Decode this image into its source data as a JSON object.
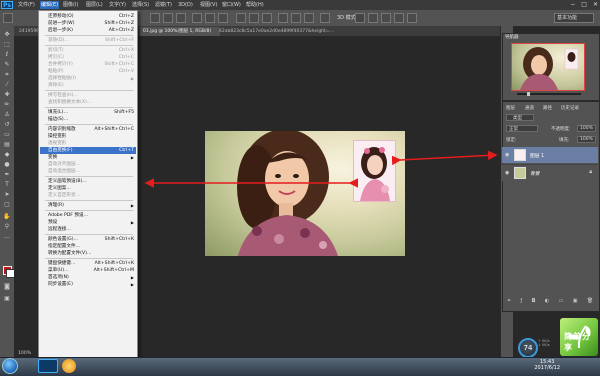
{
  "app": {
    "logo": "Ps"
  },
  "menubar": {
    "items": [
      "文件(F)",
      "编辑(E)",
      "图像(I)",
      "图层(L)",
      "文字(Y)",
      "选择(S)",
      "滤镜(T)",
      "3D(D)",
      "视图(V)",
      "窗口(W)",
      "帮助(H)"
    ],
    "active_index": 1,
    "window_controls": [
      "−",
      "□",
      "✕"
    ]
  },
  "options_bar": {
    "mode_3d": "3D 模式:",
    "workspace": "基本功能"
  },
  "doc_tabs": [
    {
      "label": "2419596…",
      "active": false
    },
    {
      "label": "01.jpg @ 100%(图层 1, RGB/8)",
      "active": true
    },
    {
      "label": "42ab823c8c5a17e0ae2d0e4899f40377&height=…",
      "active": false
    }
  ],
  "edit_menu": {
    "items": [
      {
        "label": "还原移动(O)",
        "shortcut": "Ctrl+Z",
        "disabled": false
      },
      {
        "label": "前进一步(W)",
        "shortcut": "Shift+Ctrl+Z",
        "disabled": false
      },
      {
        "label": "后退一步(K)",
        "shortcut": "Alt+Ctrl+Z",
        "disabled": false
      },
      {
        "sep": true
      },
      {
        "label": "渐隐(D)…",
        "shortcut": "Shift+Ctrl+F",
        "disabled": true
      },
      {
        "sep": true
      },
      {
        "label": "剪切(T)",
        "shortcut": "Ctrl+X",
        "disabled": true
      },
      {
        "label": "拷贝(C)",
        "shortcut": "Ctrl+C",
        "disabled": true
      },
      {
        "label": "合并拷贝(Y)",
        "shortcut": "Shift+Ctrl+C",
        "disabled": true
      },
      {
        "label": "粘贴(P)",
        "shortcut": "Ctrl+V",
        "disabled": true
      },
      {
        "label": "选择性粘贴(I)",
        "shortcut": "",
        "disabled": true,
        "submenu": true
      },
      {
        "label": "清除(E)",
        "shortcut": "",
        "disabled": true
      },
      {
        "sep": true
      },
      {
        "label": "拼写检查(H)…",
        "shortcut": "",
        "disabled": true
      },
      {
        "label": "查找和替换文本(X)…",
        "shortcut": "",
        "disabled": true
      },
      {
        "sep": true
      },
      {
        "label": "填充(L)…",
        "shortcut": "Shift+F5",
        "disabled": false
      },
      {
        "label": "描边(S)…",
        "shortcut": "",
        "disabled": false
      },
      {
        "sep": true
      },
      {
        "label": "内容识别缩放",
        "shortcut": "Alt+Shift+Ctrl+C",
        "disabled": false
      },
      {
        "label": "操控变形",
        "shortcut": "",
        "disabled": false
      },
      {
        "label": "透视变形",
        "shortcut": "",
        "disabled": true
      },
      {
        "label": "自由变换(F)",
        "shortcut": "Ctrl+T",
        "disabled": false,
        "highlight": true
      },
      {
        "label": "变换",
        "shortcut": "",
        "disabled": false,
        "submenu": true
      },
      {
        "label": "自动对齐图层…",
        "shortcut": "",
        "disabled": true
      },
      {
        "label": "自动混合图层…",
        "shortcut": "",
        "disabled": true
      },
      {
        "sep": true
      },
      {
        "label": "定义画笔预设(B)…",
        "shortcut": "",
        "disabled": false
      },
      {
        "label": "定义图案…",
        "shortcut": "",
        "disabled": false
      },
      {
        "label": "定义自定形状…",
        "shortcut": "",
        "disabled": true
      },
      {
        "sep": true
      },
      {
        "label": "清理(R)",
        "shortcut": "",
        "disabled": false,
        "submenu": true
      },
      {
        "sep": true
      },
      {
        "label": "Adobe PDF 预设…",
        "shortcut": "",
        "disabled": false
      },
      {
        "label": "预设",
        "shortcut": "",
        "disabled": false,
        "submenu": true
      },
      {
        "label": "远程连接…",
        "shortcut": "",
        "disabled": false
      },
      {
        "sep": true
      },
      {
        "label": "颜色设置(G)…",
        "shortcut": "Shift+Ctrl+K",
        "disabled": false
      },
      {
        "label": "指定配置文件…",
        "shortcut": "",
        "disabled": false
      },
      {
        "label": "转换为配置文件(V)…",
        "shortcut": "",
        "disabled": false
      },
      {
        "sep": true
      },
      {
        "label": "键盘快捷键…",
        "shortcut": "Alt+Shift+Ctrl+K",
        "disabled": false
      },
      {
        "label": "菜单(U)…",
        "shortcut": "Alt+Shift+Ctrl+M",
        "disabled": false
      },
      {
        "label": "首选项(N)",
        "shortcut": "",
        "disabled": false,
        "submenu": true
      },
      {
        "label": "同步设置(E)",
        "shortcut": "",
        "disabled": false,
        "submenu": true
      }
    ]
  },
  "navigator": {
    "tab": "导航器"
  },
  "layers_panel": {
    "tabs": [
      "图层",
      "通道",
      "路径",
      "历史记录"
    ],
    "kind_filter": "类型",
    "blend_mode": "正常",
    "opacity_label": "不透明度:",
    "opacity_value": "100%",
    "lock_label": "锁定:",
    "fill_label": "填充:",
    "fill_value": "100%",
    "layers": [
      {
        "name": "图层 1",
        "selected": true
      },
      {
        "name": "背景",
        "selected": false,
        "locked": true
      }
    ]
  },
  "status": {
    "zoom": "100%"
  },
  "taskbar": {
    "time": "15:43",
    "date": "2017/6/12"
  },
  "widget": {
    "speed_value": "74",
    "speed_unit_up": "↑ 0K/s",
    "speed_unit_down": "↓ 0K/s"
  },
  "watermark": {
    "text": "简单分享"
  }
}
